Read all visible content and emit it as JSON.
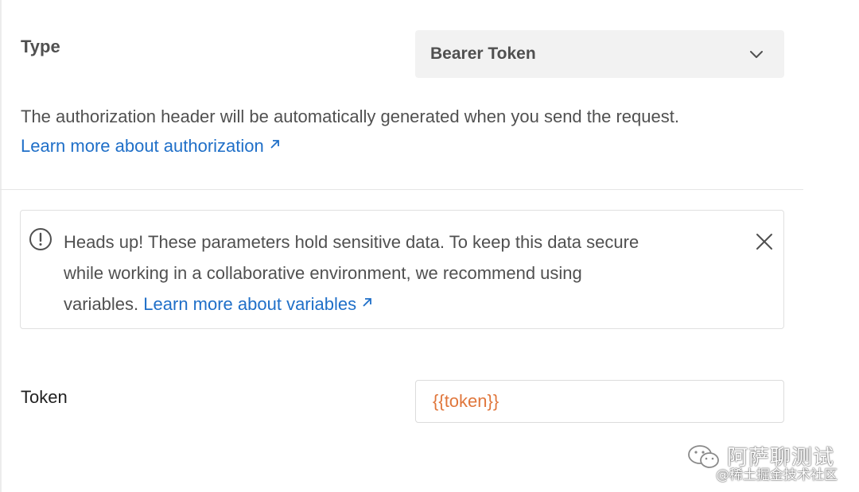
{
  "auth": {
    "type_label": "Type",
    "type_value": "Bearer Token",
    "description": "The authorization header will be automatically generated when you send the request.",
    "learn_more_auth": "Learn more about authorization"
  },
  "alert": {
    "line1": "Heads up! These parameters hold sensitive data. To keep this data secure",
    "line2": "while working in a collaborative environment, we recommend using",
    "line3_prefix": "variables.",
    "learn_more_vars": "Learn more about variables"
  },
  "token": {
    "label": "Token",
    "value": "{{token}}"
  },
  "watermark": {
    "account": "阿萨聊测试",
    "community": "@稀土掘金技术社区"
  },
  "colors": {
    "link": "#1f6fc8",
    "variable": "#e0763b",
    "select_bg": "#f2f2f2"
  },
  "icons": {
    "type_chevron": "chevron-down-icon",
    "link_arrow": "external-link-arrow-icon",
    "alert": "exclamation-circle-icon",
    "dismiss": "close-icon",
    "watermark": "wechat-icon"
  }
}
